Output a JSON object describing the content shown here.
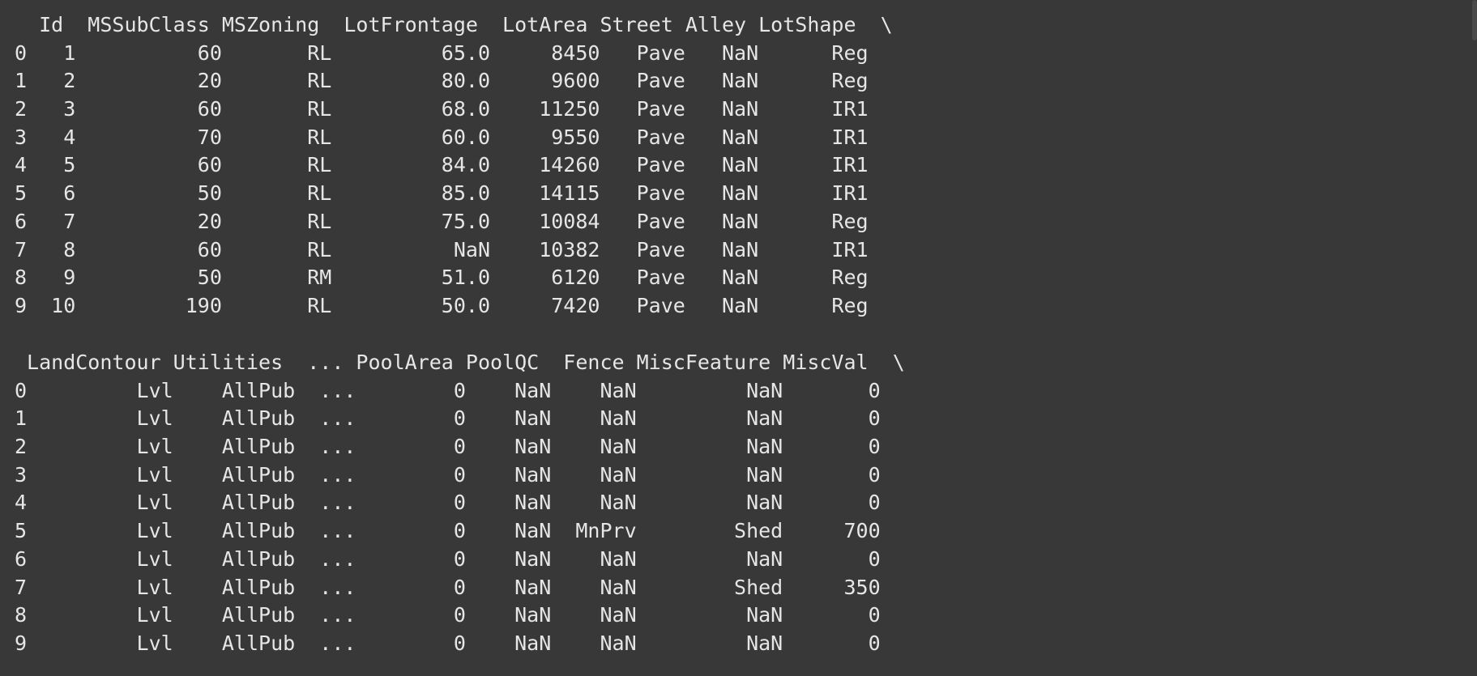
{
  "output": {
    "block1": [
      "  Id  MSSubClass MSZoning  LotFrontage  LotArea Street Alley LotShape  \\",
      "0   1          60       RL         65.0     8450   Pave   NaN      Reg",
      "1   2          20       RL         80.0     9600   Pave   NaN      Reg",
      "2   3          60       RL         68.0    11250   Pave   NaN      IR1",
      "3   4          70       RL         60.0     9550   Pave   NaN      IR1",
      "4   5          60       RL         84.0    14260   Pave   NaN      IR1",
      "5   6          50       RL         85.0    14115   Pave   NaN      IR1",
      "6   7          20       RL         75.0    10084   Pave   NaN      Reg",
      "7   8          60       RL          NaN    10382   Pave   NaN      IR1",
      "8   9          50       RM         51.0     6120   Pave   NaN      Reg",
      "9  10         190       RL         50.0     7420   Pave   NaN      Reg"
    ],
    "block2": [
      " LandContour Utilities  ... PoolArea PoolQC  Fence MiscFeature MiscVal  \\",
      "0         Lvl    AllPub  ...        0    NaN    NaN         NaN       0",
      "1         Lvl    AllPub  ...        0    NaN    NaN         NaN       0",
      "2         Lvl    AllPub  ...        0    NaN    NaN         NaN       0",
      "3         Lvl    AllPub  ...        0    NaN    NaN         NaN       0",
      "4         Lvl    AllPub  ...        0    NaN    NaN         NaN       0",
      "5         Lvl    AllPub  ...        0    NaN  MnPrv        Shed     700",
      "6         Lvl    AllPub  ...        0    NaN    NaN         NaN       0",
      "7         Lvl    AllPub  ...        0    NaN    NaN        Shed     350",
      "8         Lvl    AllPub  ...        0    NaN    NaN         NaN       0",
      "9         Lvl    AllPub  ...        0    NaN    NaN         NaN       0"
    ]
  },
  "colors": {
    "background": "#383838",
    "text": "#e6e6e6"
  }
}
